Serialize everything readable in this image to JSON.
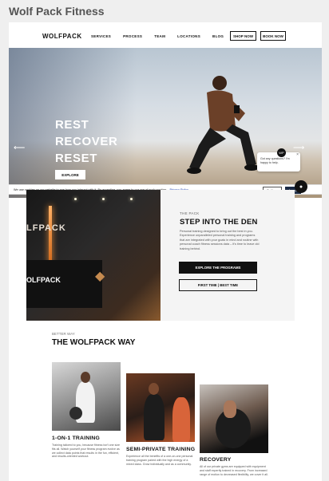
{
  "page_title": "Wolf Pack Fitness",
  "nav": {
    "logo": "WOLFPACK",
    "links": [
      "SERVICES",
      "PROCESS",
      "TEAM",
      "LOCATIONS",
      "BLOG"
    ],
    "shop_now": "SHOP NOW",
    "book_now": "BOOK NOW"
  },
  "hero": {
    "lines": [
      "REST",
      "RECOVER",
      "RESET"
    ],
    "button": "EXPLORE",
    "arrow_left": "⟵",
    "arrow_right": "⟶"
  },
  "chat": {
    "message": "Got any questions? I'm happy to help.",
    "close": "×",
    "avatar": "WP",
    "launcher": "●"
  },
  "cookie": {
    "text": "We use cookies on our website to see how you interact with it. By accepting, you agree to our use of such cookies.",
    "policy_link": "Privacy Policy",
    "settings": "Settings",
    "accept": "Accept"
  },
  "den": {
    "photo_sign_top": "LFPACK",
    "photo_sign_bottom": "OLFPACK",
    "eyebrow": "THE PACK",
    "title": "STEP INTO THE DEN",
    "body": "Personal training designed to bring out the best in you. Experience unparalleled personal training and programs that are integrated with your goals in mind and routine with personal coach fitness sessions data – it's time to leave old training behind.",
    "btn_primary": "EXPLORE THE PROGRAMS",
    "btn_secondary": "FIRST TIME | BEST TIME"
  },
  "way": {
    "eyebrow": "BETTER WAY",
    "title": "THE WOLFPACK WAY"
  },
  "cards": [
    {
      "title": "1-ON-1 TRAINING",
      "body": "Training tailored to you, because fitness isn't one size fits all. Watch yourself your fitness program evolve as we collect data points that results in the fun, efficient, and results-oriented workout."
    },
    {
      "title": "SEMI-PRIVATE TRAINING",
      "body": "Experience all the benefits of a one-on-one personal training program paired with the high energy of a mixed class. Grow individually and as a community."
    },
    {
      "title": "RECOVERY",
      "body": "All of our private gyms are equipped with equipment and staff expertly trained in recovery. From increased range of motion to decreased flexibility, we cover it all."
    }
  ]
}
